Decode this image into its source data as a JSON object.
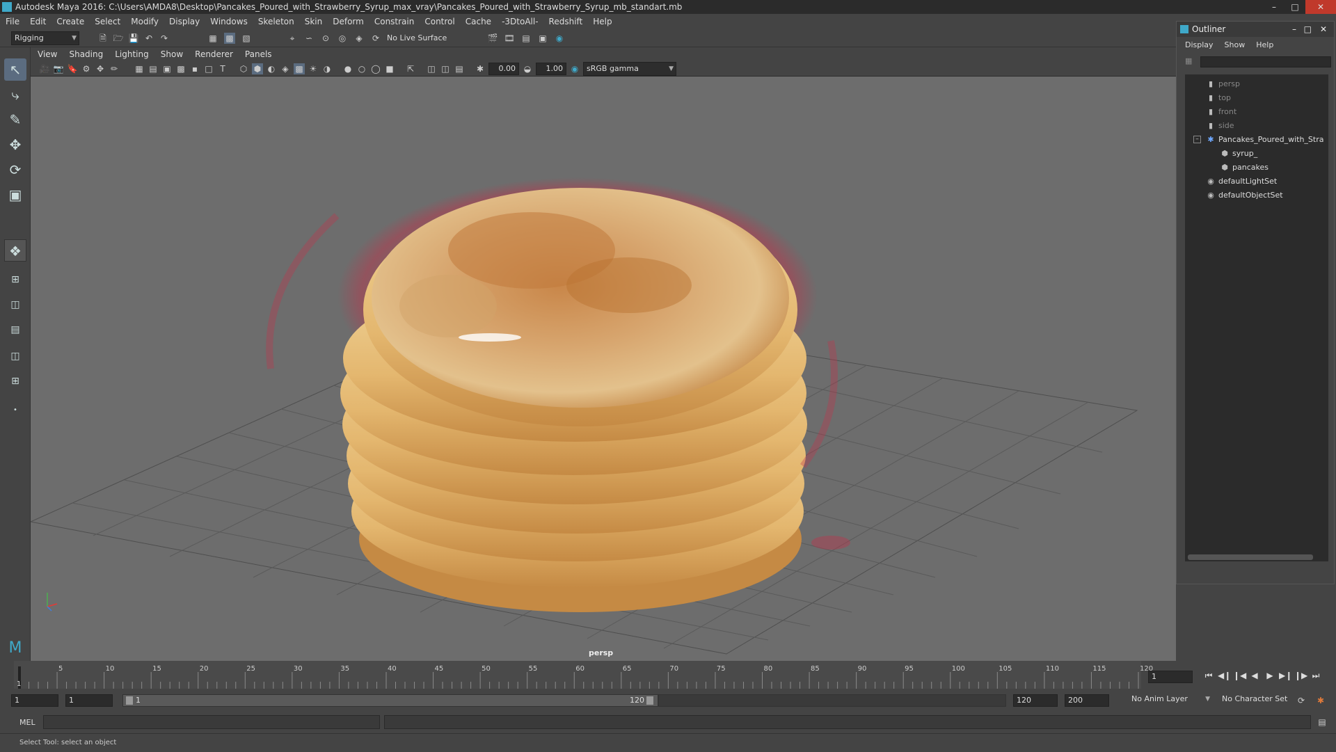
{
  "window": {
    "title": "Autodesk Maya 2016: C:\\Users\\AMDA8\\Desktop\\Pancakes_Poured_with_Strawberry_Syrup_max_vray\\Pancakes_Poured_with_Strawberry_Syrup_mb_standart.mb"
  },
  "menubar": [
    "File",
    "Edit",
    "Create",
    "Select",
    "Modify",
    "Display",
    "Windows",
    "Skeleton",
    "Skin",
    "Deform",
    "Constrain",
    "Control",
    "Cache",
    "-3DtoAll-",
    "Redshift",
    "Help"
  ],
  "shelf": {
    "menuset": "Rigging",
    "live_surface": "No Live Surface"
  },
  "panel": {
    "menus": [
      "View",
      "Shading",
      "Lighting",
      "Show",
      "Renderer",
      "Panels"
    ],
    "exposure": "0.00",
    "gamma": "1.00",
    "colorspace": "sRGB gamma",
    "camera_label": "persp"
  },
  "outliner": {
    "title": "Outliner",
    "menus": [
      "Display",
      "Show",
      "Help"
    ],
    "items": [
      {
        "label": "persp",
        "icon": "camera-icon",
        "dim": true,
        "indent": 0
      },
      {
        "label": "top",
        "icon": "camera-icon",
        "dim": true,
        "indent": 0
      },
      {
        "label": "front",
        "icon": "camera-icon",
        "dim": true,
        "indent": 0
      },
      {
        "label": "side",
        "icon": "camera-icon",
        "dim": true,
        "indent": 0
      },
      {
        "label": "Pancakes_Poured_with_Stra",
        "icon": "group-icon",
        "dim": false,
        "indent": 0
      },
      {
        "label": "syrup_",
        "icon": "mesh-icon",
        "dim": false,
        "indent": 1
      },
      {
        "label": "pancakes",
        "icon": "mesh-icon",
        "dim": false,
        "indent": 1
      },
      {
        "label": "defaultLightSet",
        "icon": "set-icon",
        "dim": false,
        "indent": 0
      },
      {
        "label": "defaultObjectSet",
        "icon": "set-icon",
        "dim": false,
        "indent": 0
      }
    ]
  },
  "timeline": {
    "ticks": [
      "5",
      "10",
      "15",
      "20",
      "25",
      "30",
      "35",
      "40",
      "45",
      "50",
      "55",
      "60",
      "65",
      "70",
      "75",
      "80",
      "85",
      "90",
      "95",
      "100",
      "105",
      "110",
      "115",
      "120"
    ],
    "start_marker": "1",
    "current_frame": "1"
  },
  "range": {
    "start": "1",
    "anim_start": "1",
    "slider_start": "1",
    "slider_end": "120",
    "anim_end": "120",
    "end": "200",
    "anim_layer": "No Anim Layer",
    "character_set": "No Character Set"
  },
  "cmdline": {
    "label": "MEL"
  },
  "helpline": {
    "text": "Select Tool: select an object"
  },
  "colors": {
    "viewport_bg": "#6d6d6d",
    "accent": "#3fa9c9",
    "syrup": "#c0334a"
  }
}
